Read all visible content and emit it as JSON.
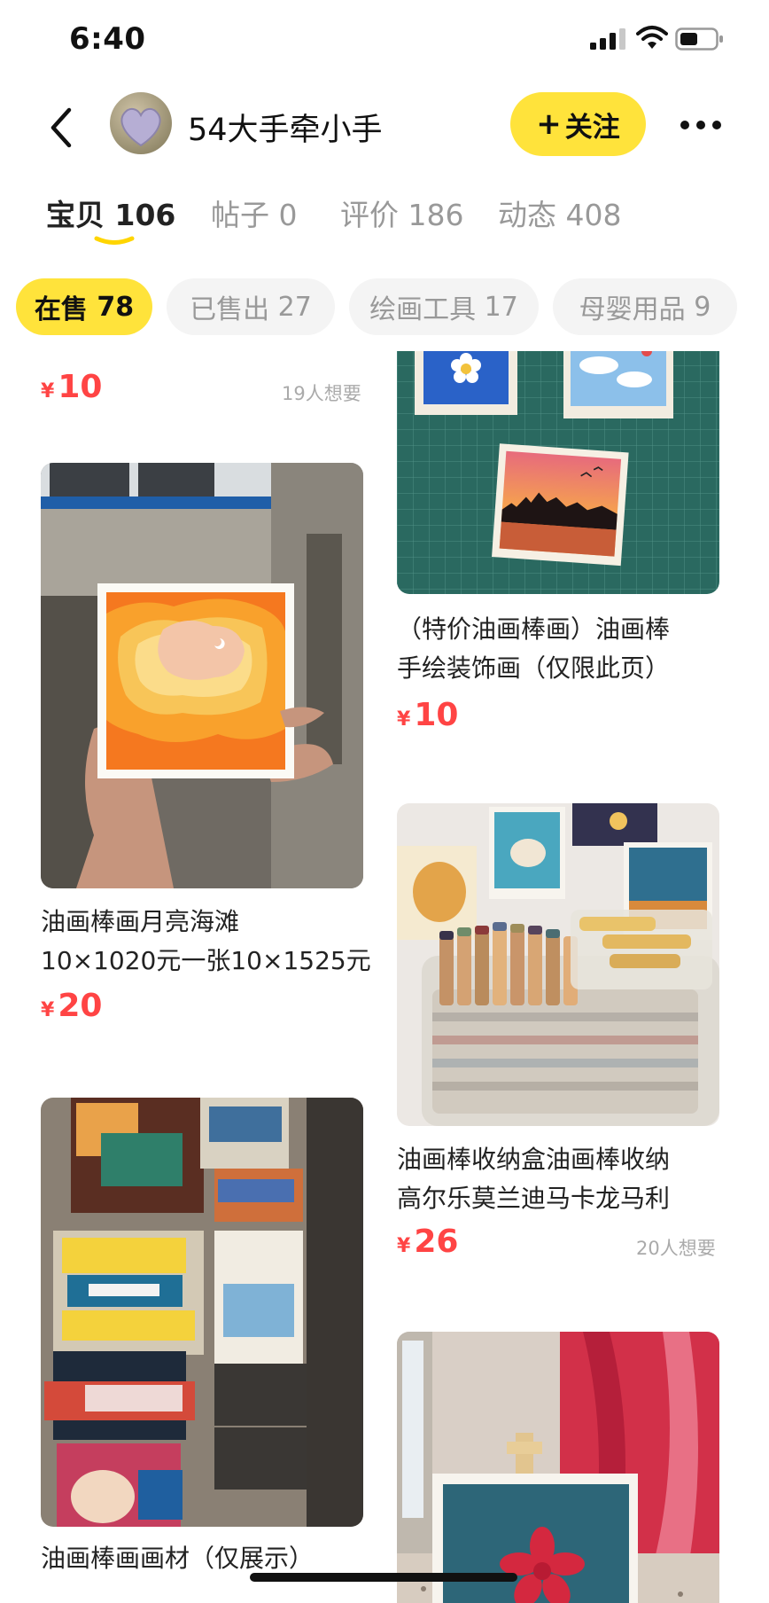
{
  "status_bar": {
    "time": "6:40"
  },
  "header": {
    "shop_name": "54大手牵小手",
    "follow_plus": "+",
    "follow_label": "关注"
  },
  "main_tabs": [
    {
      "label": "宝贝",
      "count": "106",
      "active": true
    },
    {
      "label": "帖子",
      "count": "0",
      "active": false
    },
    {
      "label": "评价",
      "count": "186",
      "active": false
    },
    {
      "label": "动态",
      "count": "408",
      "active": false
    }
  ],
  "filter_chips": [
    {
      "label": "在售",
      "count": "78",
      "active": true
    },
    {
      "label": "已售出",
      "count": "27",
      "active": false
    },
    {
      "label": "绘画工具",
      "count": "17",
      "active": false
    },
    {
      "label": "母婴用品",
      "count": "9",
      "active": false
    }
  ],
  "currency_symbol": "¥",
  "products": {
    "top_left_partial": {
      "price": "10",
      "wants": "19人想要"
    },
    "top_right_partial": {
      "title_line1": "（特价油画棒画）油画棒",
      "title_line2": "手绘装饰画（仅限此页）",
      "price": "10"
    },
    "moon_beach": {
      "title_line1": "油画棒画月亮海滩",
      "title_line2": "10×1020元一张10×1525元",
      "price": "20"
    },
    "storage_box": {
      "title_line1": "油画棒收纳盒油画棒收纳",
      "title_line2": "高尔乐莫兰迪马卡龙马利",
      "price": "26",
      "wants": "20人想要"
    },
    "materials": {
      "title_line1": "油画棒画画材（仅展示）",
      "title_line2": ""
    },
    "flower_card": {}
  },
  "colors": {
    "accent_yellow": "#ffe33b",
    "price_red": "#ff4444",
    "muted_text": "#999999"
  },
  "icons": {
    "back": "chevron-left",
    "more": "ellipsis-horizontal",
    "signal": "cellular-signal",
    "wifi": "wifi",
    "battery": "battery-half"
  }
}
